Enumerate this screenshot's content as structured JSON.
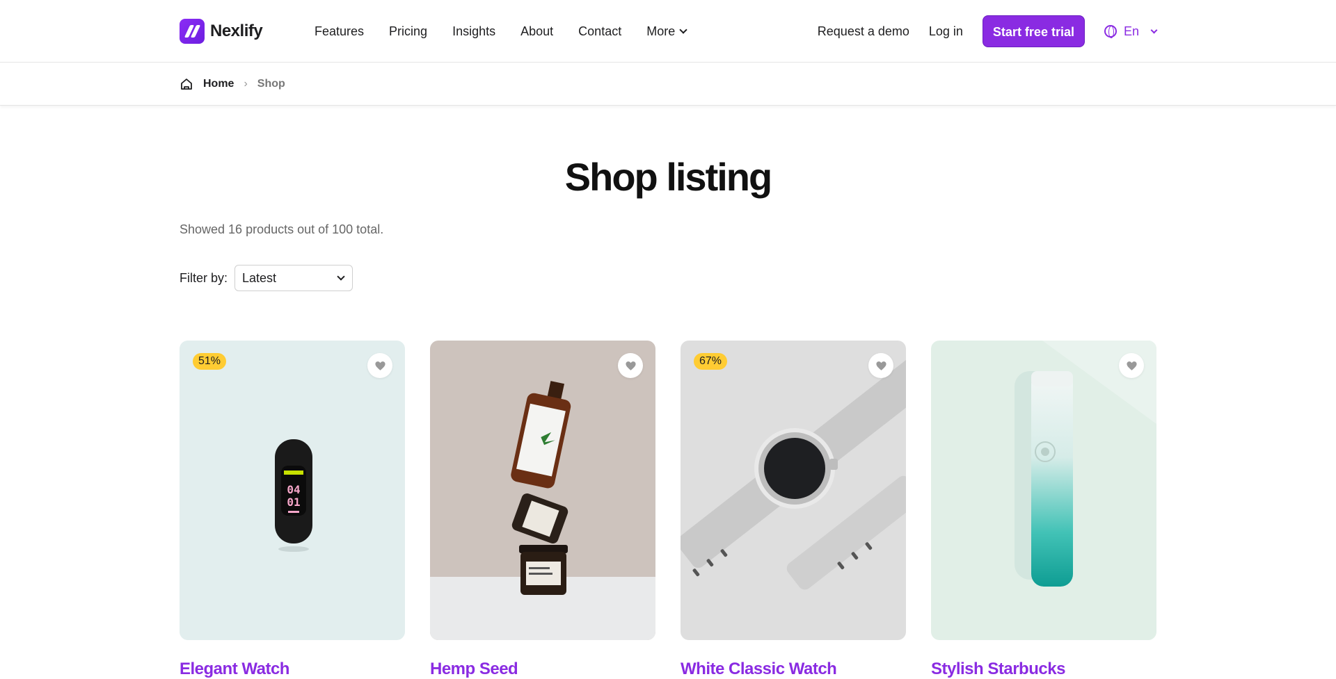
{
  "brand": {
    "name": "Nexlify"
  },
  "nav": {
    "links": [
      "Features",
      "Pricing",
      "Insights",
      "About",
      "Contact",
      "More"
    ],
    "request_demo": "Request a demo",
    "login": "Log in",
    "cta": "Start free trial",
    "language": "En"
  },
  "breadcrumb": {
    "home": "Home",
    "separator": "›",
    "current": "Shop"
  },
  "page": {
    "title": "Shop listing",
    "result_count": "Showed 16 products out of 100 total.",
    "filter_label": "Filter by:",
    "filter_value": "Latest"
  },
  "products": [
    {
      "title": "Elegant Watch",
      "badge": "51%",
      "bg": "#e2eeee"
    },
    {
      "title": "Hemp Seed",
      "badge": "",
      "bg": "#cdc3bd"
    },
    {
      "title": "White Classic Watch",
      "badge": "67%",
      "bg": "#dedede"
    },
    {
      "title": "Stylish Starbucks",
      "badge": "",
      "bg": "#e1efe7"
    }
  ],
  "colors": {
    "accent": "#8a2be2",
    "badge": "#ffcc33"
  }
}
